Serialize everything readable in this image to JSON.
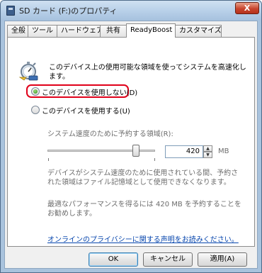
{
  "window": {
    "title": "SD カード (F:)のプロパティ",
    "close_label": "X"
  },
  "tabs": [
    {
      "label": "全般",
      "active": false
    },
    {
      "label": "ツール",
      "active": false
    },
    {
      "label": "ハードウェア",
      "active": false
    },
    {
      "label": "共有",
      "active": false
    },
    {
      "label": "ReadyBoost",
      "active": true
    },
    {
      "label": "カスタマイズ",
      "active": false
    }
  ],
  "readyboost": {
    "description": "このデバイス上の使用可能な領域を使ってシステムを高速化します。",
    "option_disable": "このデバイスを使用しない(D)",
    "option_enable": "このデバイスを使用する(U)",
    "selected_option": "disable",
    "reserve_label": "システム速度のために予約する領域(R):",
    "reserve_value": "420",
    "reserve_unit": "MB",
    "warning_text": "デバイスがシステム速度のために使用されている間、予約された領域はファイル記憶域として使用できなくなります。",
    "recommend_text": "最適なパフォーマンスを得るには 420 MB を予約することをお勧めします。",
    "privacy_link": "オンラインのプライバシーに関する声明をお読みください。",
    "slider_fraction": 0.82
  },
  "buttons": {
    "ok": "OK",
    "cancel": "キャンセル",
    "apply": "適用(A)"
  },
  "colors": {
    "highlight": "#e0001a",
    "link": "#0645ad"
  },
  "icons": {
    "title": "drive-icon",
    "readyboost": "readyboost-stopwatch-icon"
  }
}
